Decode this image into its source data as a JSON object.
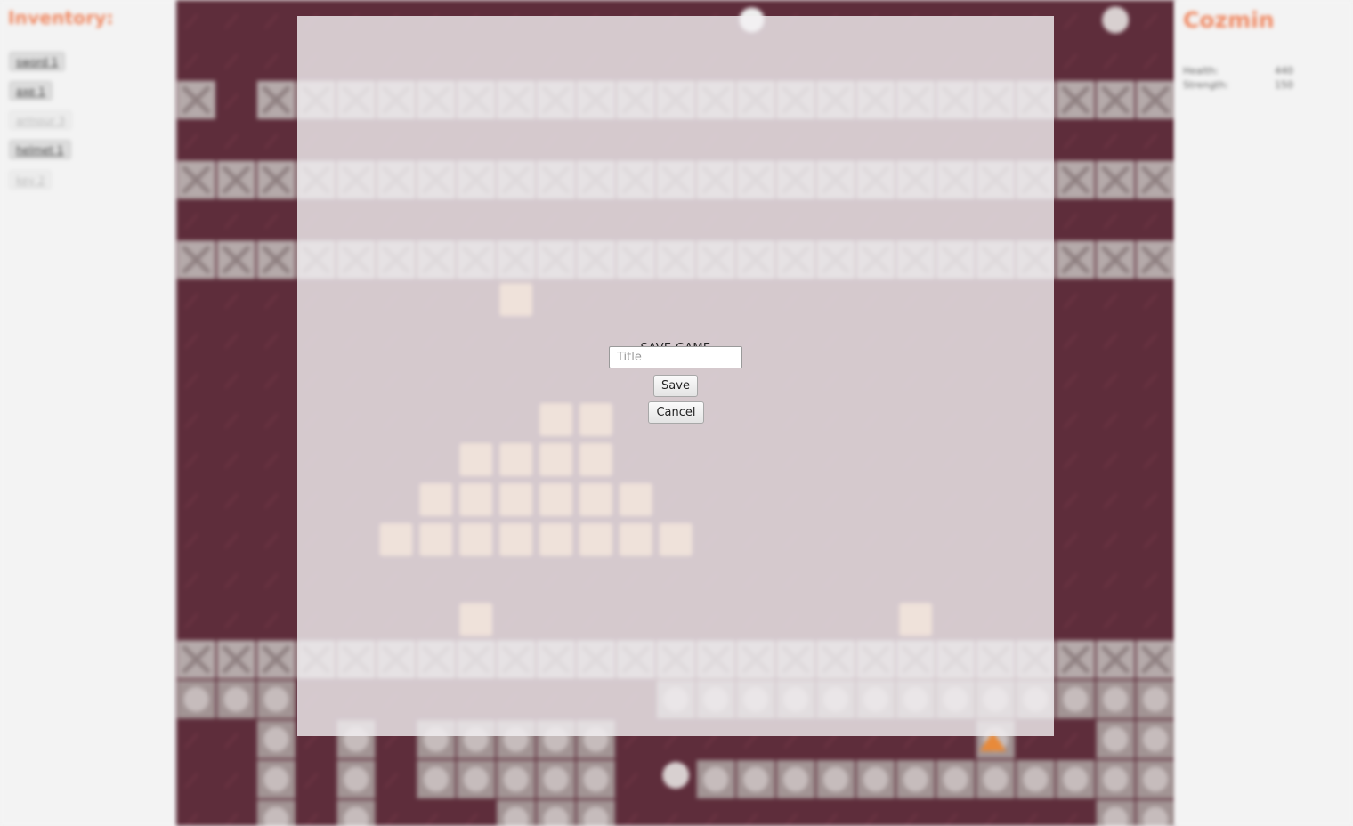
{
  "inventory": {
    "title": "Inventory:",
    "items": [
      {
        "label": "sword 1",
        "enabled": true
      },
      {
        "label": "axe 1",
        "enabled": true
      },
      {
        "label": "armour 3",
        "enabled": false
      },
      {
        "label": "helmet 1",
        "enabled": true
      },
      {
        "label": "key 2",
        "enabled": false
      }
    ]
  },
  "player": {
    "name": "Cozmin",
    "stats": [
      {
        "label": "Health:",
        "value": "440"
      },
      {
        "label": "Strength:",
        "value": "150"
      }
    ]
  },
  "save_dialog": {
    "title": "SAVE GAME",
    "input_value": "",
    "input_placeholder": "Title",
    "save_label": "Save",
    "cancel_label": "Cancel"
  },
  "colors": {
    "accent": "#f08a64",
    "floor": "#5e2d3b",
    "wall_light": "#b5aaaa",
    "wall_dark": "#8e7f80",
    "crate": "#e0a878"
  },
  "tiles": {
    "floor": "dark-red-floor",
    "wall": "cross-pattern-wall",
    "stone": "round-stone-wall",
    "crate": "wooden-crate",
    "player": "hero-sprite",
    "enemy": "skeleton-sprite",
    "fire": "campfire"
  }
}
